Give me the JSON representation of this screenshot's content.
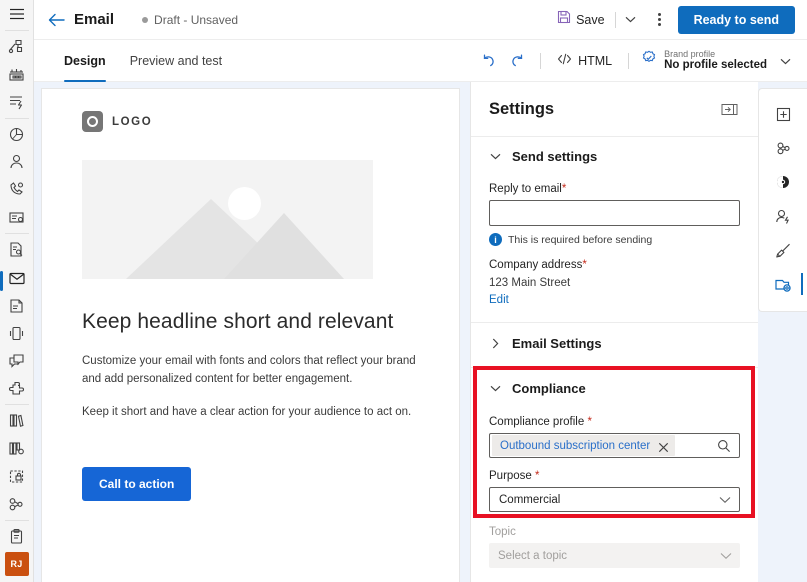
{
  "header": {
    "back_icon": "arrow-left-icon",
    "title": "Email",
    "status": "Draft - Unsaved",
    "save_label": "Save",
    "save_icon": "save-disk-icon",
    "save_chevron_icon": "chevron-down-icon",
    "more_icon": "more-vertical-icon",
    "primary_button": "Ready to send"
  },
  "toolbar": {
    "tabs": [
      {
        "label": "Design",
        "active": true
      },
      {
        "label": "Preview and test",
        "active": false
      }
    ],
    "undo_icon": "undo-icon",
    "redo_icon": "redo-icon",
    "html_label": "HTML",
    "html_icon": "code-icon",
    "brand_icon": "brand-badge-icon",
    "brand_caption": "Brand profile",
    "brand_value": "No profile selected",
    "brand_chevron_icon": "chevron-down-icon"
  },
  "email": {
    "logo_text": "LOGO",
    "logo_icon": "logo-mark-icon",
    "hero_icon": "image-placeholder-icon",
    "headline": "Keep headline short and relevant",
    "paragraph1": "Customize your email with fonts and colors that reflect your brand and add personalized content for better engagement.",
    "paragraph2": "Keep it short and have a clear action for your audience to act on.",
    "cta_label": "Call to action"
  },
  "settings": {
    "title": "Settings",
    "expand_icon": "expand-panel-icon",
    "send_settings": {
      "label": "Send settings",
      "chevron_icon": "chevron-down-icon",
      "reply_to_label": "Reply to email",
      "reply_to_required": "*",
      "reply_to_value": "",
      "reply_to_placeholder": "",
      "hint_icon": "info-icon",
      "hint_glyph": "i",
      "hint_text": "This is required before sending",
      "company_address_label": "Company address",
      "company_address_required": "*",
      "company_address_value": "123 Main Street",
      "edit_link": "Edit"
    },
    "email_settings": {
      "label": "Email Settings",
      "chevron_icon": "chevron-right-icon"
    },
    "compliance": {
      "label": "Compliance",
      "chevron_icon": "chevron-down-icon",
      "profile_label": "Compliance profile",
      "profile_required": "*",
      "profile_value": "Outbound subscription center",
      "profile_clear_icon": "close-icon",
      "profile_search_icon": "search-icon",
      "purpose_label": "Purpose",
      "purpose_required": "*",
      "purpose_value": "Commercial",
      "purpose_chevron_icon": "chevron-down-icon",
      "topic_label": "Topic",
      "topic_placeholder": "Select a topic",
      "topic_chevron_icon": "chevron-down-icon"
    },
    "highlight_color": "#e81123"
  },
  "left_rail": {
    "menu_icon": "hamburger-menu-icon",
    "items": [
      {
        "name": "sitemap-icon"
      },
      {
        "name": "dashboard-grid-icon"
      },
      {
        "name": "activity-list-icon"
      },
      {
        "name": "analytics-pie-icon"
      },
      {
        "name": "contact-person-icon"
      },
      {
        "name": "customer-voice-icon"
      },
      {
        "name": "card-form-icon"
      },
      {
        "name": "segment-doc-icon"
      },
      {
        "name": "email-envelope-icon",
        "active": true
      },
      {
        "name": "push-notification-icon"
      },
      {
        "name": "mobile-device-icon"
      },
      {
        "name": "text-message-icon"
      },
      {
        "name": "custom-channel-icon"
      },
      {
        "name": "library-assets-icon"
      },
      {
        "name": "templates-icon"
      },
      {
        "name": "forms-icon"
      },
      {
        "name": "journeys-icon"
      },
      {
        "name": "clipboard-tasks-icon"
      }
    ],
    "avatar_initials": "RJ",
    "avatar_color": "#ca5010"
  },
  "right_rail": {
    "items": [
      {
        "name": "add-element-icon"
      },
      {
        "name": "layouts-icon"
      },
      {
        "name": "themes-icon"
      },
      {
        "name": "personalization-icon"
      },
      {
        "name": "styles-brush-icon"
      },
      {
        "name": "settings-panel-icon",
        "active": true
      }
    ]
  },
  "colors": {
    "accent": "#0f6cbd",
    "cta": "#1666d6",
    "highlight": "#e81123",
    "required": "#c42b1c"
  }
}
